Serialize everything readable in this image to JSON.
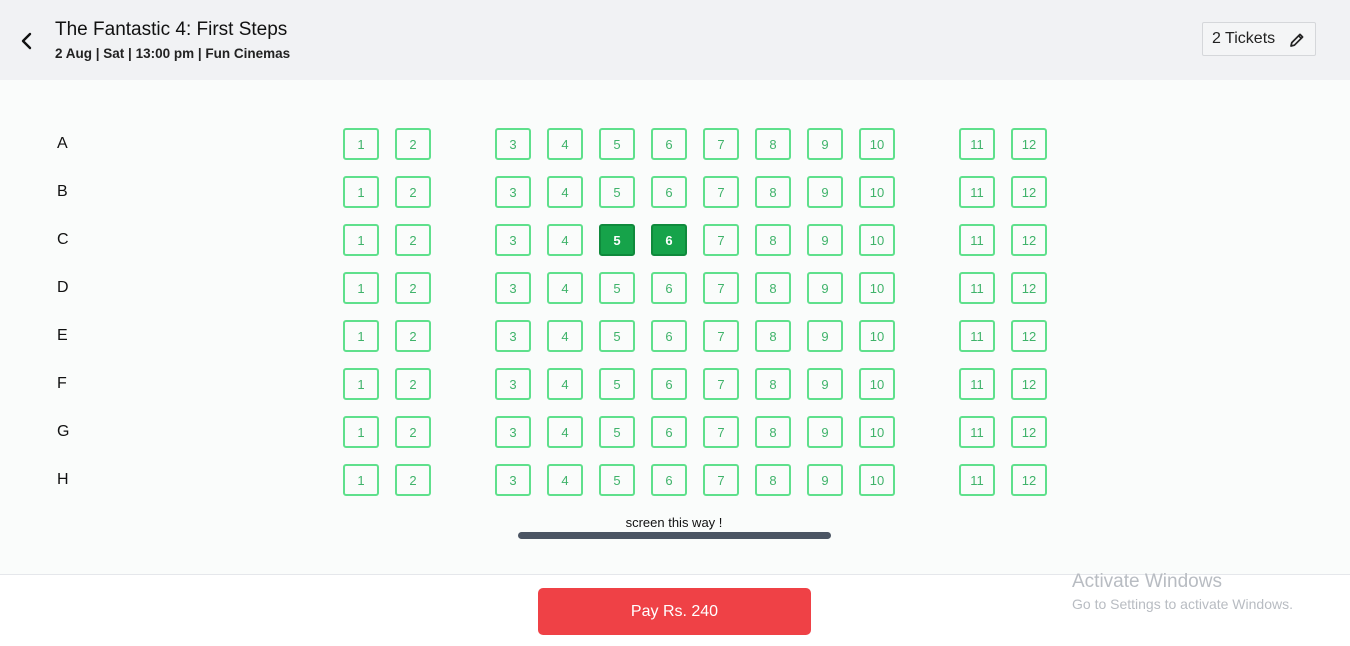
{
  "header": {
    "title": "The Fantastic 4: First Steps",
    "subtitle": "2 Aug | Sat | 13:00 pm | Fun Cinemas",
    "tickets_label": "2 Tickets"
  },
  "icons": {
    "back": "chevron-left-icon",
    "edit": "pencil-icon"
  },
  "seat_map": {
    "rows": [
      "A",
      "B",
      "C",
      "D",
      "E",
      "F",
      "G",
      "H"
    ],
    "seats": [
      "1",
      "2",
      "3",
      "4",
      "5",
      "6",
      "7",
      "8",
      "9",
      "10",
      "11",
      "12"
    ],
    "selected": [
      {
        "row": "C",
        "seat": "5"
      },
      {
        "row": "C",
        "seat": "6"
      }
    ]
  },
  "screen": {
    "label": "screen this way !"
  },
  "footer": {
    "pay_label": "Pay Rs. 240"
  },
  "watermark": {
    "title": "Activate Windows",
    "subtitle": "Go to Settings to activate Windows."
  },
  "colors": {
    "seat_border": "#5fe08c",
    "seat_text": "#3fb36a",
    "seat_selected": "#16a34a",
    "pay_button": "#ef4146",
    "screen_bar": "#4b5563"
  }
}
